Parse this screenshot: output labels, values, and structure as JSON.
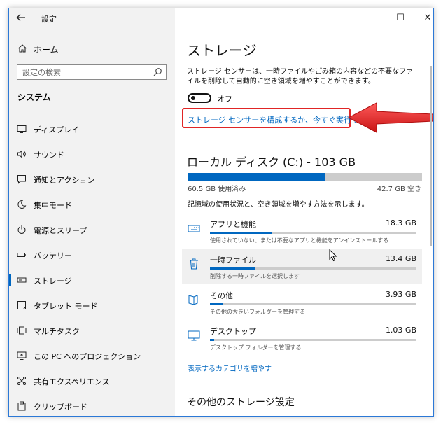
{
  "window": {
    "title": "設定",
    "controls": {
      "minimize": "—",
      "maximize": "☐",
      "close": "✕"
    }
  },
  "sidebar": {
    "home_label": "ホーム",
    "search_placeholder": "設定の検索",
    "section_title": "システム",
    "items": [
      {
        "label": "ディスプレイ",
        "icon": "display-icon"
      },
      {
        "label": "サウンド",
        "icon": "speaker-icon"
      },
      {
        "label": "通知とアクション",
        "icon": "notification-icon"
      },
      {
        "label": "集中モード",
        "icon": "moon-icon"
      },
      {
        "label": "電源とスリープ",
        "icon": "power-icon"
      },
      {
        "label": "バッテリー",
        "icon": "battery-icon"
      },
      {
        "label": "ストレージ",
        "icon": "storage-icon",
        "active": true
      },
      {
        "label": "タブレット モード",
        "icon": "tablet-icon"
      },
      {
        "label": "マルチタスク",
        "icon": "multitask-icon"
      },
      {
        "label": "この PC へのプロジェクション",
        "icon": "projection-icon"
      },
      {
        "label": "共有エクスペリエンス",
        "icon": "share-icon"
      },
      {
        "label": "クリップボード",
        "icon": "clipboard-icon"
      }
    ]
  },
  "main": {
    "title": "ストレージ",
    "description": "ストレージ センサーは、一時ファイルやごみ箱の内容などの不要なファイルを削除して自動的に空き領域を増やすことができます。",
    "toggle_label": "オフ",
    "configure_link": "ストレージ センサーを構成するか、今すぐ実行する",
    "drive": {
      "title": "ローカル ディスク (C:) - 103 GB",
      "used": "60.5 GB 使用済み",
      "free": "42.7 GB 空き",
      "used_fraction": 0.587
    },
    "usage_desc": "記憶域の使用状況と、空き領域を増やす方法を示します。",
    "categories": [
      {
        "name": "アプリと機能",
        "size": "18.3 GB",
        "sub": "使用されていない、または不要なアプリと機能をアンインストールする",
        "fraction": 0.3,
        "icon": "keyboard-icon"
      },
      {
        "name": "一時ファイル",
        "size": "13.4 GB",
        "sub": "削除する一時ファイルを選択します",
        "fraction": 0.22,
        "icon": "trash-icon"
      },
      {
        "name": "その他",
        "size": "3.93 GB",
        "sub": "その他の大きいフォルダーを管理する",
        "fraction": 0.065,
        "icon": "folder-icon"
      },
      {
        "name": "デスクトップ",
        "size": "1.03 GB",
        "sub": "デスクトップ フォルダーを管理する",
        "fraction": 0.02,
        "icon": "monitor-icon"
      }
    ],
    "more_link": "表示するカテゴリを増やす",
    "other_title": "その他のストレージ設定"
  },
  "colors": {
    "accent": "#0067c0",
    "highlight": "#e02525"
  }
}
